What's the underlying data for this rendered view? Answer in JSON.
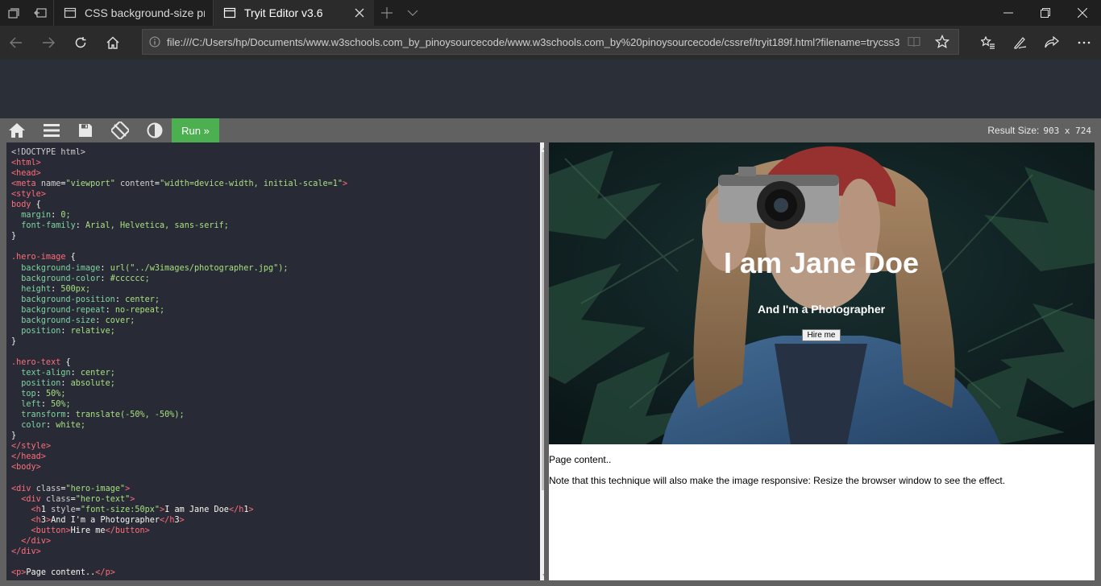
{
  "browser": {
    "tabs": [
      {
        "title": "CSS background-size prope",
        "active": false
      },
      {
        "title": "Tryit Editor v3.6",
        "active": true
      }
    ],
    "address": "file:///C:/Users/hp/Documents/www.w3schools.com_by_pinoysourcecode/www.w3schools.com_by%20pinoysourcecode/cssref/tryit189f.html?filename=trycss3"
  },
  "toolbar": {
    "run_label": "Run »",
    "result_size_label": "Result Size:",
    "result_size_value": "903 x 724"
  },
  "code_lines": [
    "<!DOCTYPE html>",
    "<html>",
    "<head>",
    "<meta name=\"viewport\" content=\"width=device-width, initial-scale=1\">",
    "<style>",
    "body {",
    "  margin: 0;",
    "  font-family: Arial, Helvetica, sans-serif;",
    "}",
    "",
    ".hero-image {",
    "  background-image: url(\"../w3images/photographer.jpg\");",
    "  background-color: #cccccc;",
    "  height: 500px;",
    "  background-position: center;",
    "  background-repeat: no-repeat;",
    "  background-size: cover;",
    "  position: relative;",
    "}",
    "",
    ".hero-text {",
    "  text-align: center;",
    "  position: absolute;",
    "  top: 50%;",
    "  left: 50%;",
    "  transform: translate(-50%, -50%);",
    "  color: white;",
    "}",
    "</style>",
    "</head>",
    "<body>",
    "",
    "<div class=\"hero-image\">",
    "  <div class=\"hero-text\">",
    "    <h1 style=\"font-size:50px\">I am Jane Doe</h1>",
    "    <h3>And I'm a Photographer</h3>",
    "    <button>Hire me</button>",
    "  </div>",
    "</div>",
    "",
    "<p>Page content..</p>"
  ],
  "result": {
    "hero_title": "I am Jane Doe",
    "hero_subtitle": "And I'm a Photographer",
    "hero_button": "Hire me",
    "paragraph1": "Page content..",
    "paragraph2": "Note that this technique will also make the image responsive: Resize the browser window to see the effect."
  }
}
